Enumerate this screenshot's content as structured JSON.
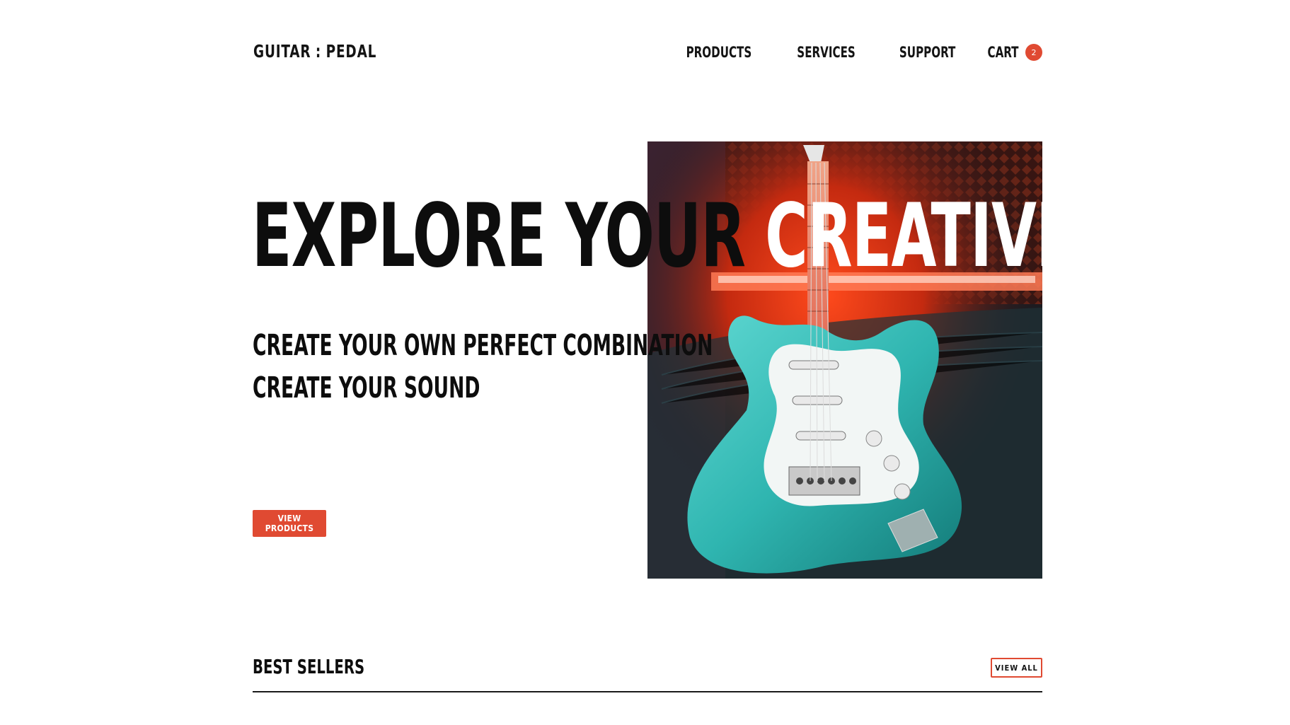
{
  "header": {
    "logo_left": "GUITAR",
    "logo_sep": ":",
    "logo_right": "PEDAL",
    "nav": {
      "products": "PRODUCTS",
      "services": "SERVICES",
      "support": "SUPPORT",
      "cart": "CART",
      "cart_count": "2"
    }
  },
  "hero": {
    "title_dark": "EXPLORE YOUR ",
    "title_light": "CREATIVITY",
    "subtitle_line1": "CREATE YOUR OWN PERFECT COMBINATION",
    "subtitle_line2": "CREATE YOUR SOUND",
    "cta": "VIEW PRODUCTS",
    "image_icon": "electric-guitar-photo"
  },
  "best_sellers": {
    "title": "BEST SELLERS",
    "view_all": "VIEW ALL"
  },
  "colors": {
    "accent": "#e04a32",
    "text": "#0d0d0d",
    "background": "#ffffff"
  }
}
